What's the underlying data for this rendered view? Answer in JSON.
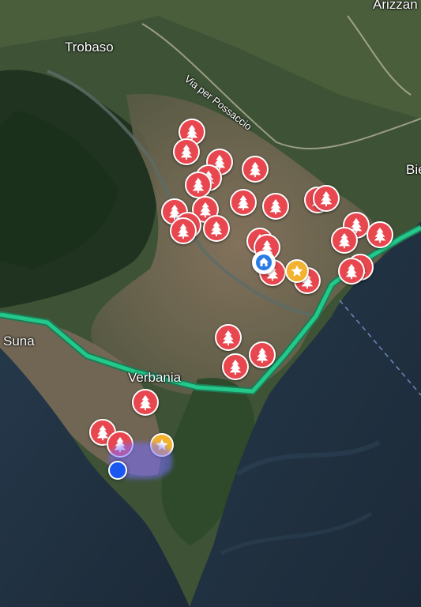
{
  "map": {
    "type": "satellite",
    "route_color": "#22c98a",
    "pin_color": "#e8474f",
    "home_color": "#2a7be4",
    "star_color": "#f2b12e",
    "location_color": "#1a56f0"
  },
  "labels": {
    "trobaso": "Trobaso",
    "suna": "Suna",
    "verbania": "Verbania",
    "arizzano": "Arizzan",
    "bie": "Bie",
    "road": "Via per Possaccio"
  },
  "markers": {
    "tree_icon": "tree-icon",
    "home_icon": "home-icon",
    "star_icon": "star-icon",
    "tree_count": 36
  }
}
